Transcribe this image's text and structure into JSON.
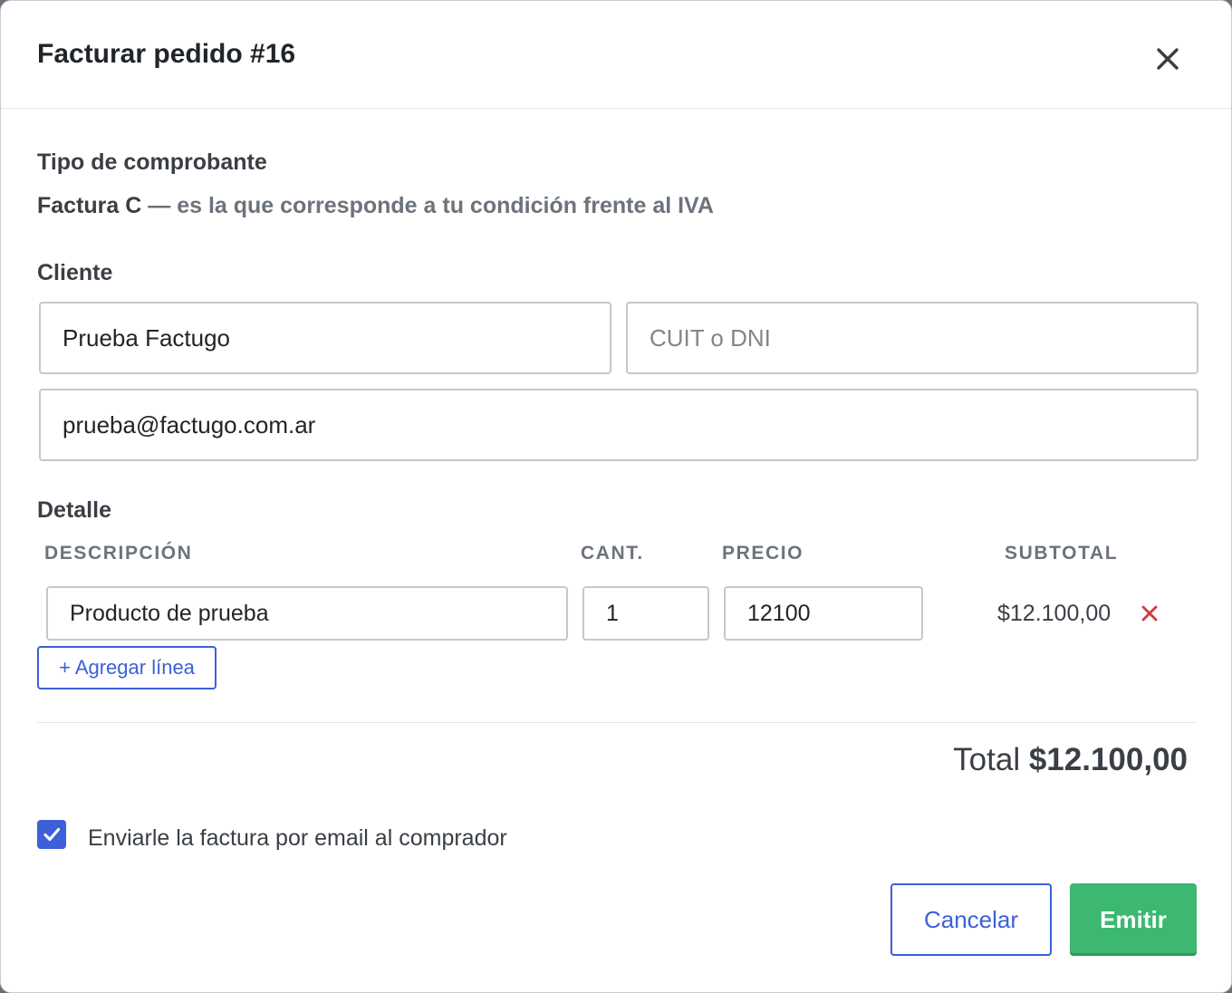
{
  "modal": {
    "title": "Facturar pedido #16",
    "close_icon": "close-icon"
  },
  "tipo": {
    "label": "Tipo de comprobante",
    "type_name": "Factura C",
    "description": " — es la que corresponde a tu condición frente al IVA"
  },
  "cliente": {
    "label": "Cliente",
    "name_value": "Prueba Factugo",
    "doc_placeholder": "CUIT o DNI",
    "doc_value": "",
    "email_value": "prueba@factugo.com.ar"
  },
  "detalle": {
    "label": "Detalle",
    "columns": {
      "descripcion": "DESCRIPCIÓN",
      "cantidad": "CANT.",
      "precio": "PRECIO",
      "subtotal": "SUBTOTAL"
    },
    "lines": [
      {
        "descripcion": "Producto de prueba",
        "cantidad": "1",
        "precio": "12100",
        "subtotal": "$12.100,00"
      }
    ],
    "add_line_label": "+ Agregar línea"
  },
  "total": {
    "label": "Total ",
    "amount": "$12.100,00"
  },
  "email_option": {
    "checked": true,
    "label": "Enviarle la factura por email al comprador"
  },
  "actions": {
    "cancel_label": "Cancelar",
    "emit_label": "Emitir"
  },
  "colors": {
    "primary": "#3d5fd9",
    "success": "#3cb870",
    "danger": "#d0393e"
  }
}
